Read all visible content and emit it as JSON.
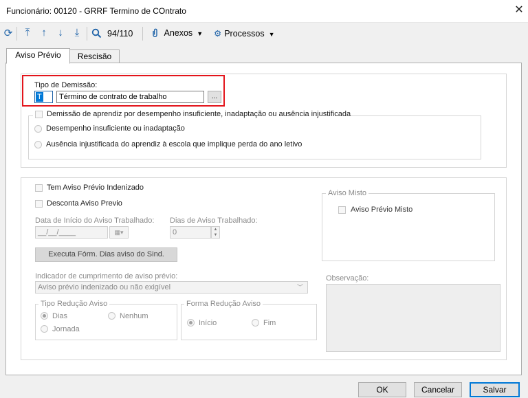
{
  "window": {
    "title": "Funcionário: 00120 - GRRF Termino de COntrato"
  },
  "toolbar": {
    "record_counter": "94/110",
    "attachments_label": "Anexos",
    "processes_label": "Processos"
  },
  "tabs": [
    {
      "label": "Aviso Prévio"
    },
    {
      "label": "Rescisão"
    }
  ],
  "highlight_color": "#e3141b",
  "tipo_demissao": {
    "label": "Tipo de Demissão:",
    "code": "T",
    "description": "Término de contrato de trabalho",
    "lookup_label": "..."
  },
  "aprendiz": {
    "checkbox_label": "Demissão de aprendiz por desempenho insuficiente, inadaptação ou ausência injustificada",
    "option1": "Desempenho insuficiente ou inadaptação",
    "option2": "Ausência injustificada do aprendiz à escola que implique perda do ano letivo"
  },
  "aviso": {
    "tem_aviso_label": "Tem Aviso Prévio Indenizado",
    "desconta_label": "Desconta Aviso Previo",
    "data_inicio_label": "Data de Início do Aviso Trabalhado:",
    "data_inicio_value": "__/__/____",
    "dias_label": "Dias de Aviso Trabalhado:",
    "dias_value": "0",
    "executa_button": "Executa Fórm. Dias aviso do Sind.",
    "indicador_label": "Indicador de cumprimento de aviso prévio:",
    "indicador_value": "Aviso prévio indenizado ou não exigível"
  },
  "tipo_reducao": {
    "legend": "Tipo Redução Aviso",
    "dias": "Dias",
    "nenhum": "Nenhum",
    "jornada": "Jornada"
  },
  "forma_reducao": {
    "legend": "Forma Redução Aviso",
    "inicio": "Início",
    "fim": "Fim"
  },
  "aviso_misto": {
    "legend": "Aviso Misto",
    "checkbox_label": "Aviso Prévio Misto"
  },
  "observacao": {
    "label": "Observação:"
  },
  "footer": {
    "ok": "OK",
    "cancel": "Cancelar",
    "save": "Salvar"
  }
}
